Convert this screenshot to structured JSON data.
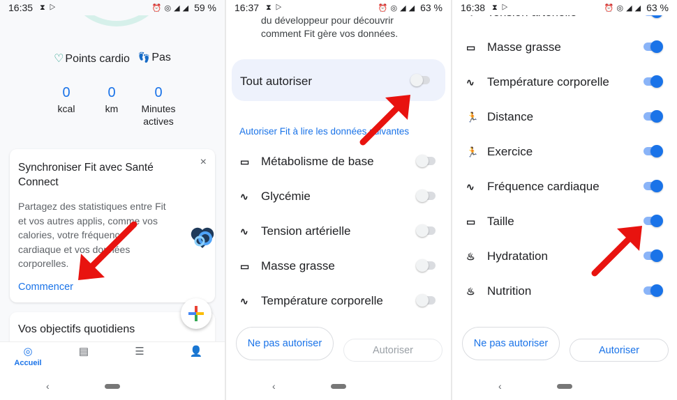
{
  "panel1": {
    "status": {
      "time": "16:35",
      "battery": "59 %"
    },
    "legend": {
      "cardio": "Points cardio",
      "steps": "Pas"
    },
    "stats": [
      {
        "value": "0",
        "label": "kcal"
      },
      {
        "value": "0",
        "label": "km"
      },
      {
        "value": "0",
        "label": "Minutes actives"
      }
    ],
    "card": {
      "title": "Synchroniser Fit avec Santé Connect",
      "body": "Partagez des statistiques entre Fit et vos autres applis, comme vos calories, votre fréquence cardiaque et vos données corporelles.",
      "cta": "Commencer",
      "close": "×"
    },
    "goals_title": "Vos objectifs quotidiens",
    "bottom_nav": {
      "home_label": "Accueil"
    }
  },
  "panel2": {
    "status": {
      "time": "16:37",
      "battery": "63 %"
    },
    "top_desc": "du développeur pour découvrir comment Fit gère vos données.",
    "allow_all_label": "Tout autoriser",
    "section_title": "Autoriser Fit à lire les données suivantes",
    "rows": [
      {
        "icon": "ruler-icon",
        "glyph": "▭",
        "label": "Métabolisme de base",
        "on": false
      },
      {
        "icon": "vitals-icon",
        "glyph": "∿",
        "label": "Glycémie",
        "on": false
      },
      {
        "icon": "vitals-icon",
        "glyph": "∿",
        "label": "Tension artérielle",
        "on": false
      },
      {
        "icon": "ruler-icon",
        "glyph": "▭",
        "label": "Masse grasse",
        "on": false
      },
      {
        "icon": "vitals-icon",
        "glyph": "∿",
        "label": "Température corporelle",
        "on": false
      }
    ],
    "buttons": {
      "deny": "Ne pas autoriser",
      "allow": "Autoriser"
    }
  },
  "panel3": {
    "status": {
      "time": "16:38",
      "battery": "63 %"
    },
    "rows": [
      {
        "icon": "vitals-icon",
        "glyph": "∿",
        "label": "Tension artérielle",
        "on": true
      },
      {
        "icon": "ruler-icon",
        "glyph": "▭",
        "label": "Masse grasse",
        "on": true
      },
      {
        "icon": "vitals-icon",
        "glyph": "∿",
        "label": "Température corporelle",
        "on": true
      },
      {
        "icon": "runner-icon",
        "glyph": "🏃",
        "label": "Distance",
        "on": true
      },
      {
        "icon": "runner-icon",
        "glyph": "🏃",
        "label": "Exercice",
        "on": true
      },
      {
        "icon": "vitals-icon",
        "glyph": "∿",
        "label": "Fréquence cardiaque",
        "on": true
      },
      {
        "icon": "ruler-icon",
        "glyph": "▭",
        "label": "Taille",
        "on": true
      },
      {
        "icon": "nutrition-icon",
        "glyph": "♨",
        "label": "Hydratation",
        "on": true
      },
      {
        "icon": "nutrition-icon",
        "glyph": "♨",
        "label": "Nutrition",
        "on": true
      }
    ],
    "buttons": {
      "deny": "Ne pas autoriser",
      "allow": "Autoriser"
    }
  },
  "colors": {
    "accent": "#1a73e8",
    "arrow": "#e8130f",
    "cardio": "#1e9c85"
  }
}
